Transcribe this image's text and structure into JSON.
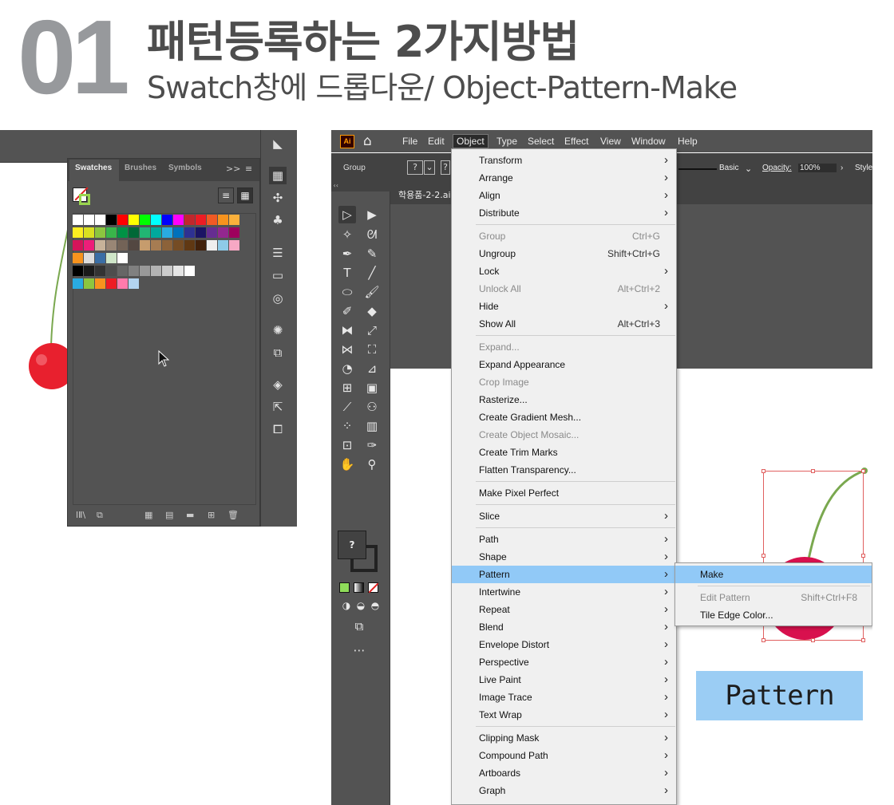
{
  "header": {
    "number": "01",
    "title": "패턴등록하는 2가지방법",
    "subtitle": "Swatch창에 드롭다운/ Object-Pattern-Make"
  },
  "swatches_panel": {
    "tabs": [
      "Swatches",
      "Brushes",
      "Symbols"
    ],
    "collapse_label": ">>",
    "swatch_rows": [
      [
        "#ffffff",
        "#ffffff",
        "#ffffff",
        "#000000",
        "#ff0000",
        "#ffff00",
        "#00ff00",
        "#00ffff",
        "#0000ff",
        "#ff00ff",
        "#c1272d",
        "#ed1c24",
        "#f15a24",
        "#f7931e",
        "#fbb03b"
      ],
      [
        "#fcee21",
        "#d9e021",
        "#8cc63f",
        "#39b54a",
        "#009245",
        "#006837",
        "#22b573",
        "#00a99d",
        "#29abe2",
        "#0071bc",
        "#2e3192",
        "#1b1464",
        "#662d91",
        "#93278f",
        "#9e005d"
      ],
      [
        "#d4145a",
        "#ed1e79",
        "#c7b299",
        "#998675",
        "#736357",
        "#534741",
        "#c69c6d",
        "#a67c52",
        "#8c6239",
        "#754c24",
        "#603813",
        "#42210b",
        "#eeeeee",
        "#8ecbe8",
        "#f7a8c4"
      ],
      [
        "#f7931e",
        "#dddddd",
        "#3a6ea5",
        "#cfe6c9",
        "#ffffff"
      ],
      [
        "#000000",
        "#1a1a1a",
        "#333333",
        "#4d4d4d",
        "#666666",
        "#808080",
        "#999999",
        "#b3b3b3",
        "#cccccc",
        "#e6e6e6",
        "#ffffff"
      ],
      [
        "#29abe2",
        "#8cc63f",
        "#f7931e",
        "#ed1c24",
        "#ff7bac",
        "#b3d4f0"
      ]
    ]
  },
  "menubar": {
    "items": [
      "File",
      "Edit",
      "Object",
      "Type",
      "Select",
      "Effect",
      "View",
      "Window",
      "Help"
    ],
    "selected": "Object"
  },
  "control_bar": {
    "selection_label": "Group",
    "stroke_style": "Basic",
    "opacity_label": "Opacity:",
    "opacity_value": "100%",
    "style_label": "Style"
  },
  "document_tab": "학용품-2-2.ai",
  "object_menu": [
    {
      "label": "Transform",
      "shortcut": "",
      "submenu": true,
      "disabled": false
    },
    {
      "label": "Arrange",
      "shortcut": "",
      "submenu": true,
      "disabled": false
    },
    {
      "label": "Align",
      "shortcut": "",
      "submenu": true,
      "disabled": false
    },
    {
      "label": "Distribute",
      "shortcut": "",
      "submenu": true,
      "disabled": false
    },
    {
      "sep": true
    },
    {
      "label": "Group",
      "shortcut": "Ctrl+G",
      "submenu": false,
      "disabled": true
    },
    {
      "label": "Ungroup",
      "shortcut": "Shift+Ctrl+G",
      "submenu": false,
      "disabled": false
    },
    {
      "label": "Lock",
      "shortcut": "",
      "submenu": true,
      "disabled": false
    },
    {
      "label": "Unlock All",
      "shortcut": "Alt+Ctrl+2",
      "submenu": false,
      "disabled": true
    },
    {
      "label": "Hide",
      "shortcut": "",
      "submenu": true,
      "disabled": false
    },
    {
      "label": "Show All",
      "shortcut": "Alt+Ctrl+3",
      "submenu": false,
      "disabled": false
    },
    {
      "sep": true
    },
    {
      "label": "Expand...",
      "shortcut": "",
      "submenu": false,
      "disabled": true
    },
    {
      "label": "Expand Appearance",
      "shortcut": "",
      "submenu": false,
      "disabled": false
    },
    {
      "label": "Crop Image",
      "shortcut": "",
      "submenu": false,
      "disabled": true
    },
    {
      "label": "Rasterize...",
      "shortcut": "",
      "submenu": false,
      "disabled": false
    },
    {
      "label": "Create Gradient Mesh...",
      "shortcut": "",
      "submenu": false,
      "disabled": false
    },
    {
      "label": "Create Object Mosaic...",
      "shortcut": "",
      "submenu": false,
      "disabled": true
    },
    {
      "label": "Create Trim Marks",
      "shortcut": "",
      "submenu": false,
      "disabled": false
    },
    {
      "label": "Flatten Transparency...",
      "shortcut": "",
      "submenu": false,
      "disabled": false
    },
    {
      "sep": true
    },
    {
      "label": "Make Pixel Perfect",
      "shortcut": "",
      "submenu": false,
      "disabled": false
    },
    {
      "sep": true
    },
    {
      "label": "Slice",
      "shortcut": "",
      "submenu": true,
      "disabled": false
    },
    {
      "sep": true
    },
    {
      "label": "Path",
      "shortcut": "",
      "submenu": true,
      "disabled": false
    },
    {
      "label": "Shape",
      "shortcut": "",
      "submenu": true,
      "disabled": false
    },
    {
      "label": "Pattern",
      "shortcut": "",
      "submenu": true,
      "disabled": false,
      "highlighted": true
    },
    {
      "label": "Intertwine",
      "shortcut": "",
      "submenu": true,
      "disabled": false
    },
    {
      "label": "Repeat",
      "shortcut": "",
      "submenu": true,
      "disabled": false
    },
    {
      "label": "Blend",
      "shortcut": "",
      "submenu": true,
      "disabled": false
    },
    {
      "label": "Envelope Distort",
      "shortcut": "",
      "submenu": true,
      "disabled": false
    },
    {
      "label": "Perspective",
      "shortcut": "",
      "submenu": true,
      "disabled": false
    },
    {
      "label": "Live Paint",
      "shortcut": "",
      "submenu": true,
      "disabled": false
    },
    {
      "label": "Image Trace",
      "shortcut": "",
      "submenu": true,
      "disabled": false
    },
    {
      "label": "Text Wrap",
      "shortcut": "",
      "submenu": true,
      "disabled": false
    },
    {
      "sep": true
    },
    {
      "label": "Clipping Mask",
      "shortcut": "",
      "submenu": true,
      "disabled": false
    },
    {
      "label": "Compound Path",
      "shortcut": "",
      "submenu": true,
      "disabled": false
    },
    {
      "label": "Artboards",
      "shortcut": "",
      "submenu": true,
      "disabled": false
    },
    {
      "label": "Graph",
      "shortcut": "",
      "submenu": true,
      "disabled": false
    }
  ],
  "pattern_submenu": [
    {
      "label": "Make",
      "shortcut": "",
      "disabled": false,
      "highlighted": true
    },
    {
      "sep": true
    },
    {
      "label": "Edit Pattern",
      "shortcut": "Shift+Ctrl+F8",
      "disabled": true
    },
    {
      "label": "Tile Edge Color...",
      "shortcut": "",
      "disabled": false
    }
  ],
  "annotation_label": "Pattern",
  "colors": {
    "ui_dark": "#535353",
    "menu_highlight": "#91c9f7",
    "cherry_red": "#e8202e",
    "cherry_magenta": "#d8114e",
    "stem_green": "#7aa84f",
    "header_gray": "#97999c"
  }
}
